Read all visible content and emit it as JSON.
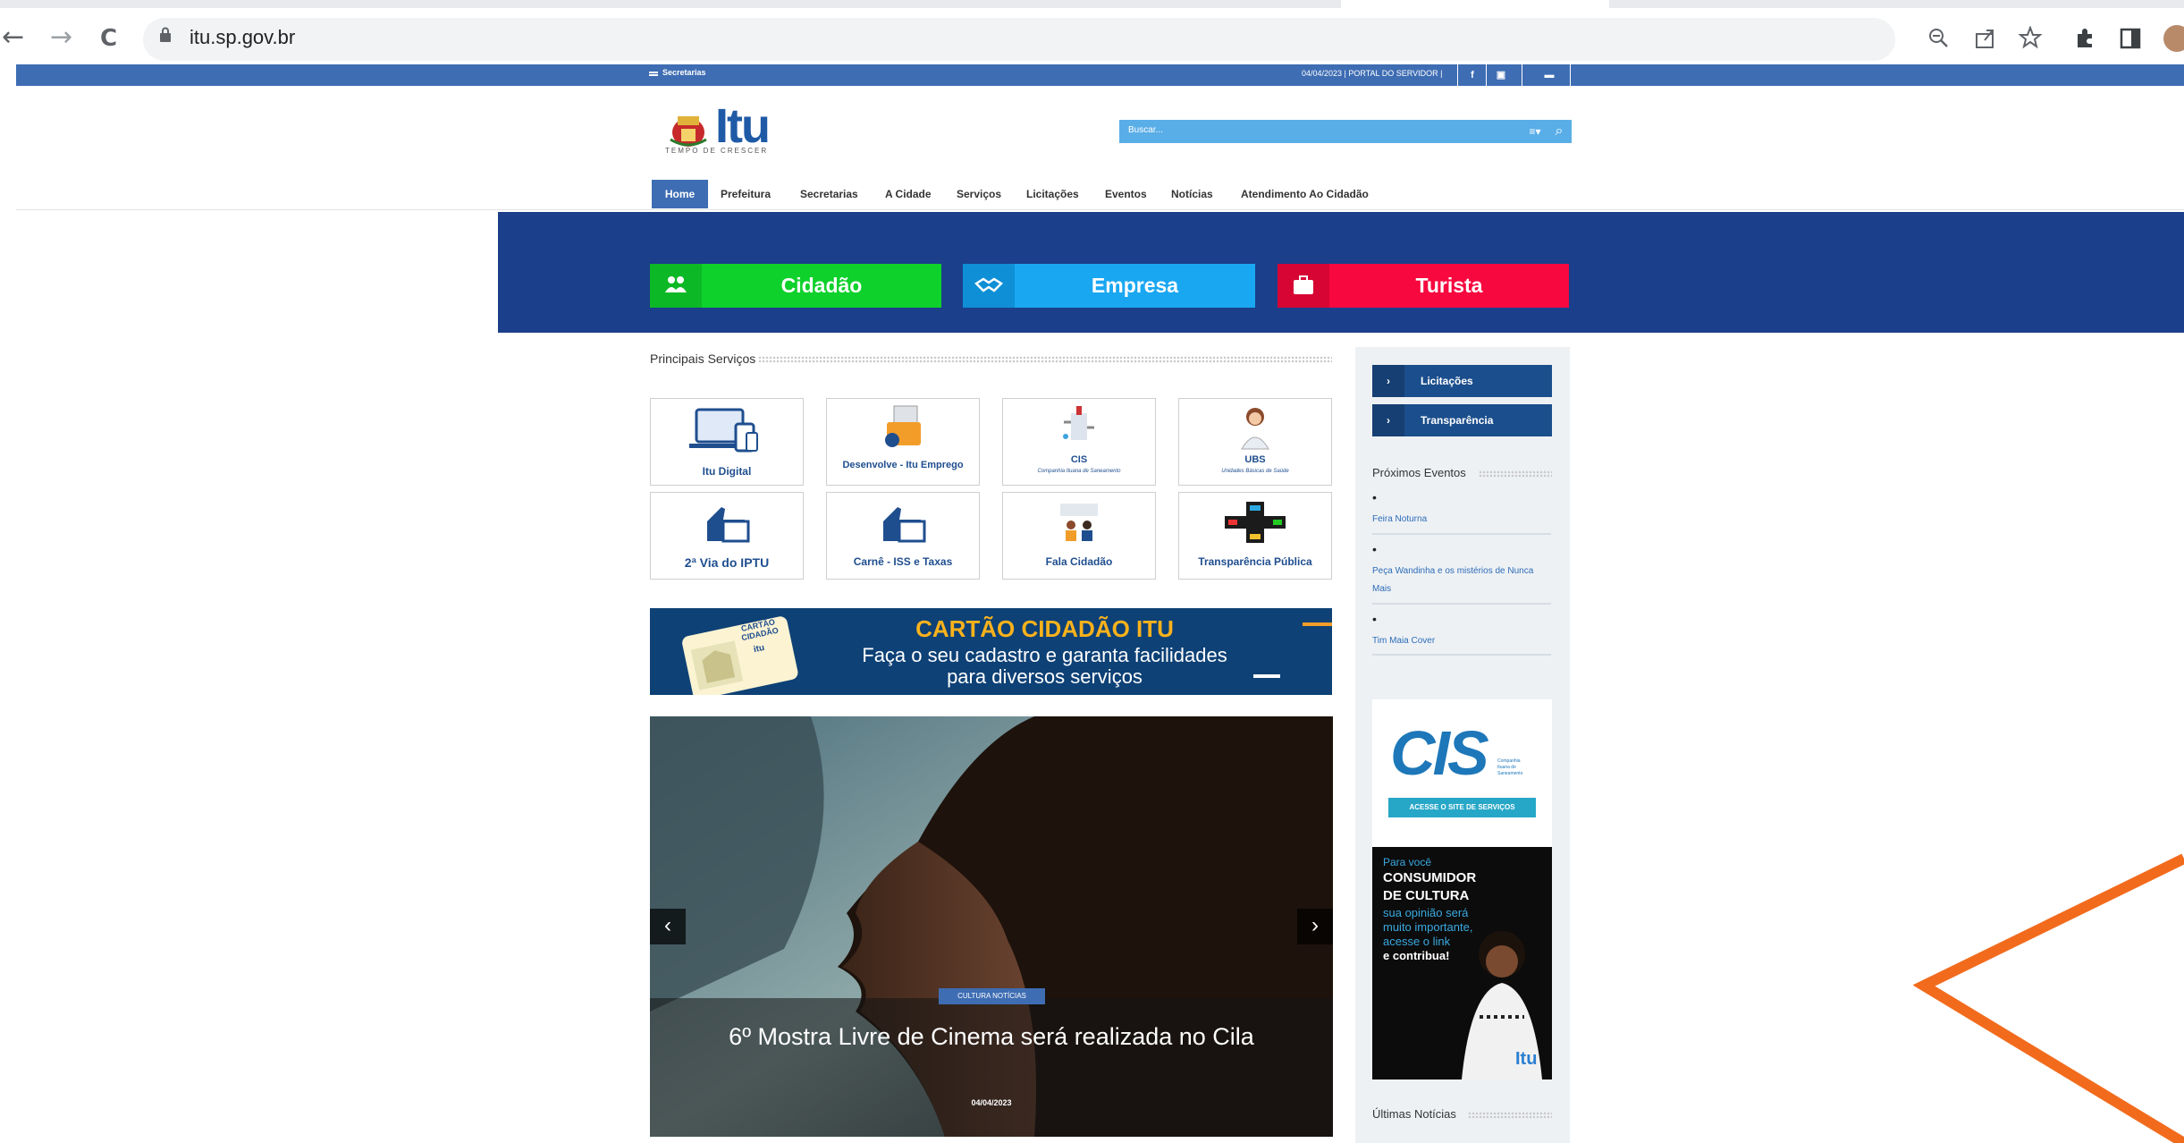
{
  "browser": {
    "url": "itu.sp.gov.br",
    "nav": {
      "back": "←",
      "forward": "→",
      "reload": "C"
    },
    "toolbar_icons": [
      "zoom-icon",
      "share-icon",
      "star-icon",
      "extensions-icon",
      "sidepanel-icon",
      "profile-icon"
    ]
  },
  "topbar": {
    "secretarias": "Secretarias",
    "right_text": "04/04/2023 | PORTAL DO SERVIDOR |",
    "social": [
      "f",
      "▣",
      "▬"
    ]
  },
  "header": {
    "logo": "Itu",
    "logo_sub": "TEMPO DE CRESCER",
    "search_placeholder": "Buscar...",
    "search_filter_icon": "≡▾",
    "search_icon": "⌕"
  },
  "menu": [
    "Home",
    "Prefeitura",
    "Secretarias",
    "A Cidade",
    "Serviços",
    "Licitações",
    "Eventos",
    "Notícias",
    "Atendimento Ao Cidadão"
  ],
  "hero": {
    "buttons": [
      {
        "label": "Cidadão",
        "icon": "users-icon",
        "color": "#0fd12c",
        "iconbg": "#0cb826"
      },
      {
        "label": "Empresa",
        "icon": "handshake-icon",
        "color": "#1aa7f2",
        "iconbg": "#0f8fd6"
      },
      {
        "label": "Turista",
        "icon": "suitcase-icon",
        "color": "#f7083f",
        "iconbg": "#d60534"
      }
    ]
  },
  "services": {
    "title": "Principais Serviços",
    "cards": [
      {
        "label": "Itu Digital",
        "sub": ""
      },
      {
        "label": "Desenvolve - Itu Emprego",
        "sub": ""
      },
      {
        "label": "CIS",
        "sub": "Companhia Ituana de Saneamento"
      },
      {
        "label": "UBS",
        "sub": "Unidades Básicas de Saúde"
      },
      {
        "label": "2ª Via do IPTU",
        "sub": ""
      },
      {
        "label": "Carnê - ISS e Taxas",
        "sub": ""
      },
      {
        "label": "Fala Cidadão",
        "sub": ""
      },
      {
        "label": "Transparência Pública",
        "sub": ""
      }
    ]
  },
  "banner": {
    "title": "CARTÃO CIDADÃO ITU",
    "line2": "Faça o seu cadastro e garanta facilidades",
    "line3": "para diversos serviços",
    "card_text": "CARTÃO CIDADÃO",
    "card_logo": "itu"
  },
  "slider": {
    "tag": "CULTURA NOTÍCIAS",
    "title": "6º Mostra Livre de Cinema será realizada no Cila",
    "date": "04/04/2023",
    "prev": "‹",
    "next": "›"
  },
  "sidebar": {
    "buttons": [
      {
        "label": "Licitações",
        "chev": "›"
      },
      {
        "label": "Transparência",
        "chev": "›"
      }
    ],
    "events_title": "Próximos Eventos",
    "events": [
      {
        "title": "Feira Noturna"
      },
      {
        "title": "Peça Wandinha e os mistérios de Nunca Mais"
      },
      {
        "title": "Tim Maia Cover"
      }
    ],
    "bullet": "•",
    "cis": {
      "logo": "CIS",
      "tag": "Companhia Ituana de Saneamento",
      "button": "ACESSE O SITE DE SERVIÇOS"
    },
    "culture": {
      "l1": "Para você",
      "l2": "CONSUMIDOR",
      "l3": "DE CULTURA",
      "l4": "sua opinião será",
      "l5": "muito importante,",
      "l6": "acesse o link",
      "l7": "e contribua!",
      "logo": "Itu"
    },
    "news_title": "Últimas Notícias"
  },
  "colors": {
    "topbar": "#3e6db3",
    "hero": "#1b3f8b",
    "accent_arrow": "#f26b1d"
  }
}
